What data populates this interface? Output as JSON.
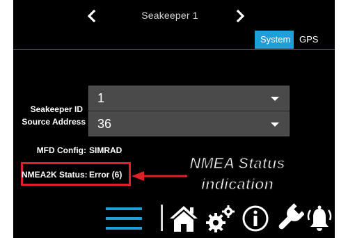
{
  "header": {
    "title": "Seakeeper 1",
    "prev_icon": "chevron-left-icon",
    "next_icon": "chevron-right-icon"
  },
  "tabs": [
    {
      "label": "System",
      "active": true
    },
    {
      "label": "GPS",
      "active": false
    }
  ],
  "form": {
    "seakeeper_id": {
      "label": "Seakeeper ID",
      "value": "1"
    },
    "source_address": {
      "label": "Source Address",
      "value": "36"
    },
    "mfd_config": {
      "label": "MFD Config:",
      "value": "SIMRAD"
    },
    "nmea2k_status": {
      "label": "NMEA2K Status:",
      "value": "Error (6)"
    }
  },
  "annotation": {
    "line1": "NMEA Status",
    "line2": "indication",
    "color": "#e01f26"
  },
  "bottom_bar": {
    "icons": [
      "menu-icon",
      "home-icon",
      "gears-icon",
      "info-icon",
      "wrench-icon",
      "alarm-bell-icon"
    ]
  },
  "colors": {
    "accent": "#1f9fd8",
    "background": "#000000",
    "dropdown": "#4a4a4a"
  }
}
